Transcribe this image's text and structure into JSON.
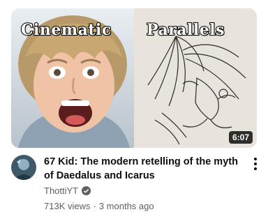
{
  "thumbnail": {
    "left_caption": "Cinematic",
    "right_caption": "Parallels",
    "duration": "6:07"
  },
  "video": {
    "title": "67 Kid: The modern retelling of the myth of Daedalus and Icarus",
    "channel": "ThottiYT",
    "views": "713K views",
    "separator": "·",
    "age": "3 months ago"
  },
  "icons": {
    "more": "more-vert-icon",
    "verified": "verified-check-icon"
  }
}
